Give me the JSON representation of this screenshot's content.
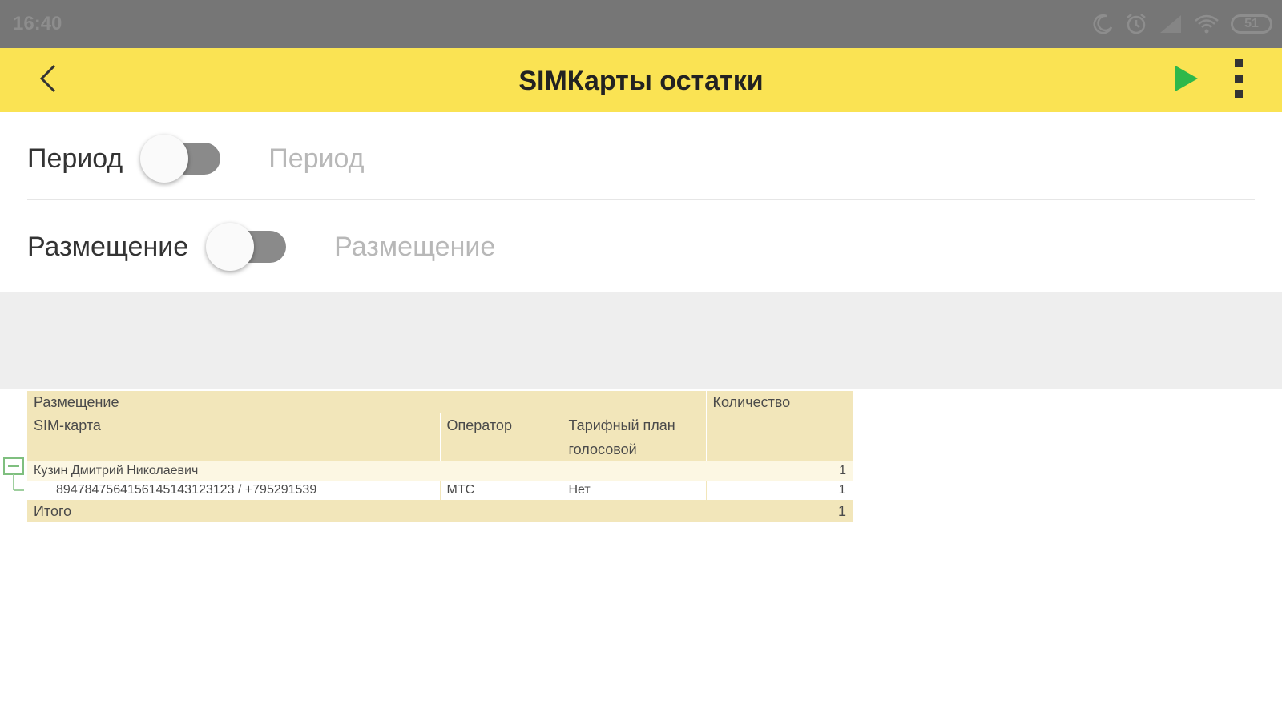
{
  "status_bar": {
    "time": "16:40",
    "battery": "51",
    "icons": [
      "moon-icon",
      "alarm-icon",
      "signal-icon",
      "wifi-icon",
      "battery-icon"
    ]
  },
  "app_bar": {
    "title": "SIMКарты остатки",
    "icons": [
      "back-arrow-icon",
      "play-icon",
      "more-vert-icon"
    ]
  },
  "filters": [
    {
      "label": "Период",
      "placeholder": "Период",
      "enabled": false
    },
    {
      "label": "Размещение",
      "placeholder": "Размещение",
      "enabled": false
    }
  ],
  "report": {
    "headers": {
      "placement": "Размещение",
      "quantity": "Количество",
      "sim_card": "SIM-карта",
      "operator": "Оператор",
      "tariff": "Тарифный план голосовой"
    },
    "group": {
      "name": "Кузин Дмитрий Николаевич",
      "quantity": "1"
    },
    "rows": [
      {
        "sim": "8947847564156145143123123 / +795291539",
        "operator": "МТС",
        "tariff": "Нет",
        "quantity": "1"
      }
    ],
    "total": {
      "label": "Итого",
      "quantity": "1"
    }
  },
  "colors": {
    "app_bar": "#fae353",
    "play_icon": "#2eb84a",
    "report_header": "#f2e6ba",
    "tree_line": "#7fbf7f"
  }
}
